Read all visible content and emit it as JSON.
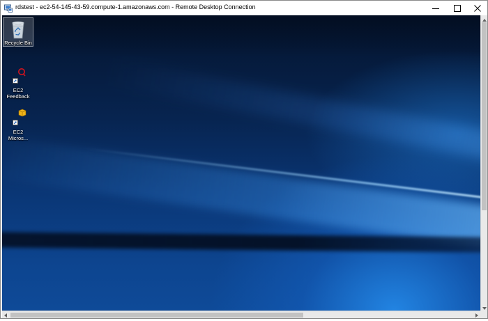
{
  "window": {
    "title": "rdstest - ec2-54-145-43-59.compute-1.amazonaws.com - Remote Desktop Connection",
    "controls": [
      "minimize-icon",
      "maximize-icon",
      "close-icon"
    ]
  },
  "desktop": {
    "icons": [
      {
        "label": "Recycle Bin",
        "icon": "recycle-bin-icon",
        "selected": true
      },
      {
        "label": "EC2\nFeedback",
        "icon": "ec2-feedback-icon",
        "shortcut": true
      },
      {
        "label": "EC2\nMicros...",
        "icon": "ec2-microsoft-icon",
        "shortcut": true
      }
    ]
  },
  "colors": {
    "title_bg": "#ffffff",
    "desktop_dark": "#04142e",
    "desktop_light": "#2387e6",
    "feedback_red": "#d0141e",
    "box_yellow": "#f0b418"
  }
}
